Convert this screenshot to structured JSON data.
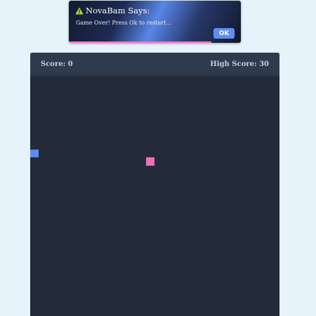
{
  "alert": {
    "title": "NovaBam Says:",
    "message": "Game Over! Press Ok to restart...",
    "ok_label": "OK",
    "icon": "warning-icon",
    "icon_color": "#a6e22e",
    "remaining_fraction": 0.83
  },
  "game": {
    "score_text": "Score: 0",
    "high_score_text": "High Score: 30",
    "snake_color": "#5b8def",
    "food_color": "#f06eb4",
    "background_color": "#232a3a"
  }
}
